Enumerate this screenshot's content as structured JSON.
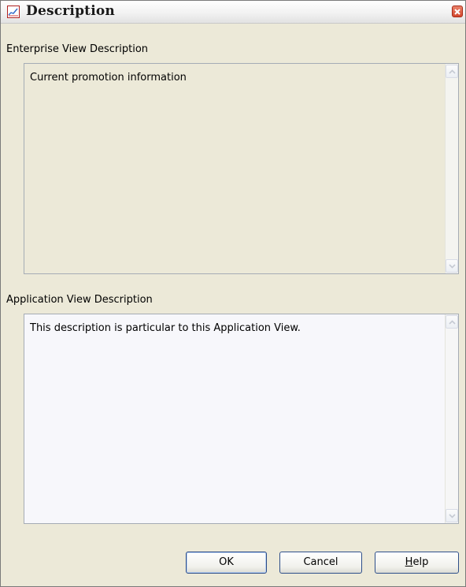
{
  "window": {
    "title": "Description"
  },
  "enterprise": {
    "label": "Enterprise View Description",
    "value": "Current promotion information"
  },
  "application": {
    "label": "Application View Description",
    "value": "This description is particular to this Application View."
  },
  "buttons": {
    "ok": "OK",
    "cancel": "Cancel",
    "help_mnemonic": "H",
    "help_rest": "elp"
  },
  "icons": {
    "app": "chart-icon",
    "close": "close-icon",
    "scroll_up": "arrow-up-icon",
    "scroll_down": "arrow-down-icon"
  },
  "colors": {
    "dialog_background": "#ece9d8",
    "button_border": "#2e4f8a",
    "close_button": "#d3482d"
  }
}
